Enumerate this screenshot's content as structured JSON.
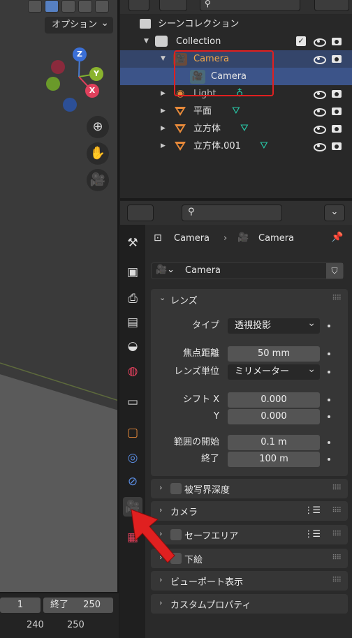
{
  "viewport": {
    "options_label": "オプション",
    "gizmo": {
      "z": "Z",
      "y": "Y",
      "x": "X"
    }
  },
  "timeline": {
    "frame_current": "1",
    "end_label": "終了",
    "end_value": "250",
    "ruler": [
      "240",
      "250"
    ]
  },
  "outliner": {
    "scene_collection": "シーンコレクション",
    "rows": [
      {
        "name": "Collection",
        "type": "collection"
      },
      {
        "name": "Camera",
        "type": "camera-object"
      },
      {
        "name": "Camera",
        "type": "camera-data"
      },
      {
        "name": "Light",
        "type": "light"
      },
      {
        "name": "平面",
        "type": "mesh"
      },
      {
        "name": "立方体",
        "type": "mesh"
      },
      {
        "name": "立方体.001",
        "type": "mesh"
      }
    ]
  },
  "properties": {
    "breadcrumb": {
      "object": "Camera",
      "data": "Camera"
    },
    "datablock_name": "Camera",
    "lens_panel": {
      "title": "レンズ",
      "type_label": "タイプ",
      "type_value": "透視投影",
      "focal_label": "焦点距離",
      "focal_value": "50 mm",
      "unit_label": "レンズ単位",
      "unit_value": "ミリメーター",
      "shift_x_label": "シフト X",
      "shift_x_value": "0.000",
      "shift_y_label": "Y",
      "shift_y_value": "0.000",
      "clip_start_label": "範囲の開始",
      "clip_start_value": "0.1 m",
      "clip_end_label": "終了",
      "clip_end_value": "100 m"
    },
    "panels": {
      "dof": "被写界深度",
      "camera": "カメラ",
      "safe_areas": "セーフエリア",
      "background": "下絵",
      "viewport_display": "ビューポート表示",
      "custom_props": "カスタムプロパティ"
    }
  },
  "colors": {
    "selection": "#3c5489",
    "camera_orange": "#e88a3a",
    "camera_teal": "#28c4a4",
    "annotation_red": "#e02020"
  }
}
